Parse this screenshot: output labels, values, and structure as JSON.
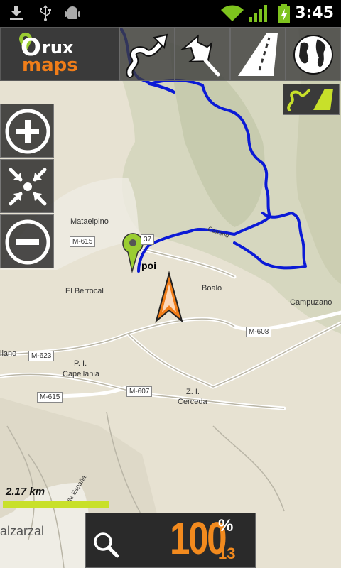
{
  "status_bar": {
    "time": "3:45"
  },
  "app": {
    "logo_o": "O",
    "logo_rux": "rux",
    "logo_maps": "maps"
  },
  "toolbar": {
    "buttons": [
      "track-icon",
      "pushpin-icon",
      "road-icon",
      "globe-icon"
    ]
  },
  "side_buttons": [
    "zoom-in-icon",
    "center-icon",
    "zoom-out-icon"
  ],
  "map": {
    "labels": {
      "mataelpino": "Mataelpino",
      "el_berrocal": "El Berrocal",
      "boalo": "Boalo",
      "campuzano": "Campuzano",
      "pi": "P. I.",
      "capellania": "Capellania",
      "zi": "Z. I.",
      "cerceda": "Cerceda",
      "llano": "llano",
      "alzarzal": "alzarzal",
      "calle_espana": "Calle España",
      "camino": "Camino"
    },
    "road_tags": {
      "m615_top": "M-615",
      "m615_bottom": "M-615",
      "m623": "M-623",
      "m607": "M-607",
      "m608": "M-608",
      "m617_partial": "37"
    },
    "poi_label": "poi"
  },
  "scale": {
    "label": "2.17 km"
  },
  "zoom_panel": {
    "zoom_pct": "100",
    "pct_sign": "%",
    "level": "13"
  },
  "colors": {
    "accent": "#f28a1e",
    "track": "#0b1ad6",
    "scale": "#c8e02a",
    "poi": "#9acd32"
  }
}
